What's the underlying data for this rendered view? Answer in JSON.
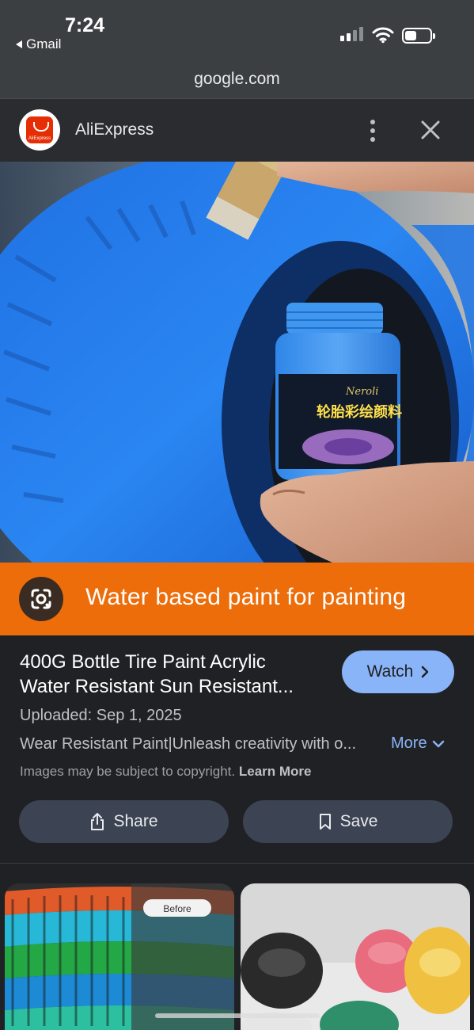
{
  "status_bar": {
    "time": "7:24",
    "back_app": "Gmail"
  },
  "browser": {
    "url": "google.com"
  },
  "header": {
    "site_name": "AliExpress",
    "logo_icon": "aliexpress-logo-icon"
  },
  "image": {
    "banner_text": "Water based paint for painting",
    "jar_brand": "Neroli",
    "jar_label": "轮胎彩绘颜料"
  },
  "details": {
    "title_line1": "400G Bottle Tire Paint Acrylic",
    "title_line2": "Water Resistant Sun Resistant...",
    "watch_label": "Watch",
    "uploaded": "Uploaded: Sep 1, 2025",
    "description": "Wear Resistant Paint|Unleash creativity with o...",
    "more_label": "More",
    "copyright_text": "Images may be subject to copyright.",
    "learn_more": "Learn More"
  },
  "actions": {
    "share_label": "Share",
    "save_label": "Save"
  },
  "related": {
    "thumb1_badge": "Before"
  },
  "colors": {
    "accent_blue": "#8ab4f8",
    "banner_orange": "#ec6d0a",
    "background": "#202124"
  }
}
